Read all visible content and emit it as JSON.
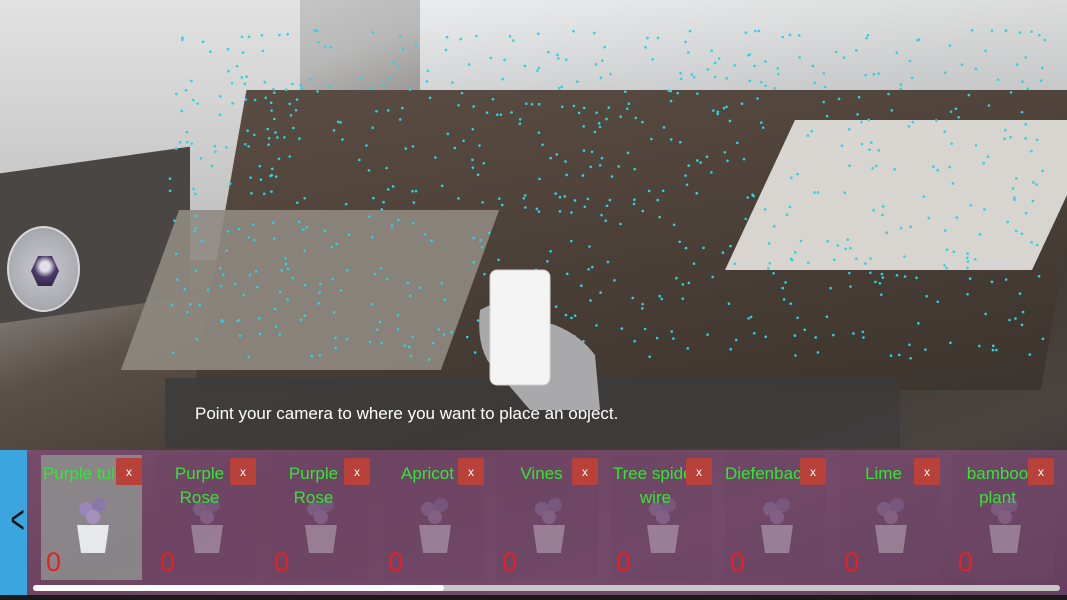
{
  "hint": {
    "text": "Point your camera to where you want to place an object."
  },
  "tray": {
    "back_icon": "chevron-left-icon",
    "scroll_position_percent": 40,
    "items": [
      {
        "name": "Purple tulip",
        "count": "0",
        "remove": "x",
        "selected": true
      },
      {
        "name": "Purple Rose",
        "count": "0",
        "remove": "x"
      },
      {
        "name": "Purple Rose",
        "count": "0",
        "remove": "x"
      },
      {
        "name": "Apricot",
        "count": "0",
        "remove": "x"
      },
      {
        "name": "Vines",
        "count": "0",
        "remove": "x"
      },
      {
        "name": "Tree spider wire",
        "count": "0",
        "remove": "x"
      },
      {
        "name": "Diefenbachia",
        "count": "0",
        "remove": "x"
      },
      {
        "name": "Lime",
        "count": "0",
        "remove": "x"
      },
      {
        "name": "bamboo plant",
        "count": "0",
        "remove": "x"
      }
    ]
  },
  "colors": {
    "accent": "#3aa5df",
    "label": "#33e633",
    "count": "#e82020",
    "remove": "#b8413a",
    "tray": "#96508c",
    "feature_points": "#2ad4e0"
  }
}
